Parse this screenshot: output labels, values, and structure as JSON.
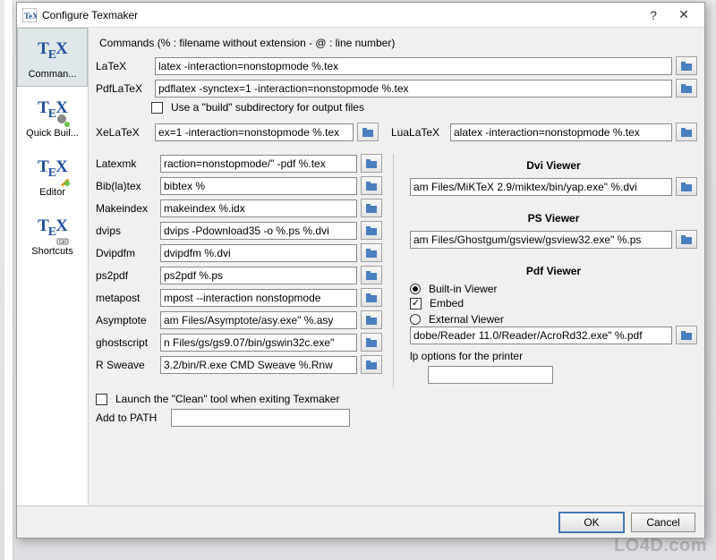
{
  "window": {
    "title": "Configure Texmaker"
  },
  "sidebar": {
    "items": [
      {
        "label": "Comman..."
      },
      {
        "label": "Quick Buil..."
      },
      {
        "label": "Editor"
      },
      {
        "label": "Shortcuts"
      }
    ]
  },
  "header": "Commands (% : filename without extension - @ : line number)",
  "top": {
    "latex_label": "LaTeX",
    "latex_value": "latex -interaction=nonstopmode %.tex",
    "pdflatex_label": "PdfLaTeX",
    "pdflatex_value": "pdflatex -synctex=1 -interaction=nonstopmode %.tex",
    "use_build_label": "Use a \"build\" subdirectory for output files",
    "xelatex_label": "XeLaTeX",
    "xelatex_value": "ex=1 -interaction=nonstopmode %.tex",
    "lualatex_label": "LuaLaTeX",
    "lualatex_value": "alatex -interaction=nonstopmode %.tex"
  },
  "left": {
    "items": [
      {
        "label": "Latexmk",
        "value": "raction=nonstopmode/\" -pdf %.tex"
      },
      {
        "label": "Bib(la)tex",
        "value": "bibtex %"
      },
      {
        "label": "Makeindex",
        "value": "makeindex %.idx"
      },
      {
        "label": "dvips",
        "value": "dvips -Pdownload35 -o %.ps %.dvi"
      },
      {
        "label": "Dvipdfm",
        "value": "dvipdfm %.dvi"
      },
      {
        "label": "ps2pdf",
        "value": "ps2pdf %.ps"
      },
      {
        "label": "metapost",
        "value": "mpost --interaction nonstopmode"
      },
      {
        "label": "Asymptote",
        "value": "am Files/Asymptote/asy.exe\" %.asy"
      },
      {
        "label": "ghostscript",
        "value": "n Files/gs/gs9.07/bin/gswin32c.exe\""
      },
      {
        "label": "R Sweave",
        "value": "3.2/bin/R.exe CMD Sweave %.Rnw"
      }
    ],
    "launch_clean": "Launch the \"Clean\" tool when exiting Texmaker",
    "add_to_path_label": "Add to PATH",
    "add_to_path_value": ""
  },
  "right": {
    "dvi_title": "Dvi Viewer",
    "dvi_value": "am Files/MiKTeX 2.9/miktex/bin/yap.exe\" %.dvi",
    "ps_title": "PS Viewer",
    "ps_value": "am Files/Ghostgum/gsview/gsview32.exe\" %.ps",
    "pdf_title": "Pdf Viewer",
    "pdf_builtin": "Built-in Viewer",
    "pdf_embed": "Embed",
    "pdf_external": "External Viewer",
    "pdf_value": "dobe/Reader 11.0/Reader/AcroRd32.exe\" %.pdf",
    "lp_label": "lp options for the printer",
    "lp_value": ""
  },
  "buttons": {
    "ok": "OK",
    "cancel": "Cancel"
  },
  "watermark": "LO4D.com"
}
